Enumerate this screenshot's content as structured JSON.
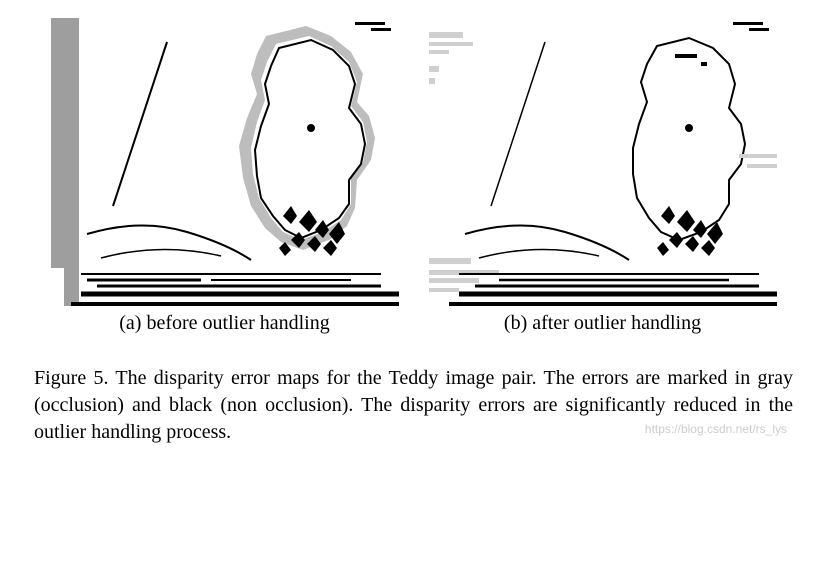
{
  "figure": {
    "sub_a": {
      "caption": "(a) before outlier handling"
    },
    "sub_b": {
      "caption": "(b) after outlier handling"
    },
    "caption": "Figure 5. The disparity error maps for the Teddy image pair. The errors are marked in gray (occlusion) and black (non occlusion). The disparity errors are significantly reduced in the outlier handling process."
  },
  "watermark": "https://blog.csdn.net/rs_lys"
}
